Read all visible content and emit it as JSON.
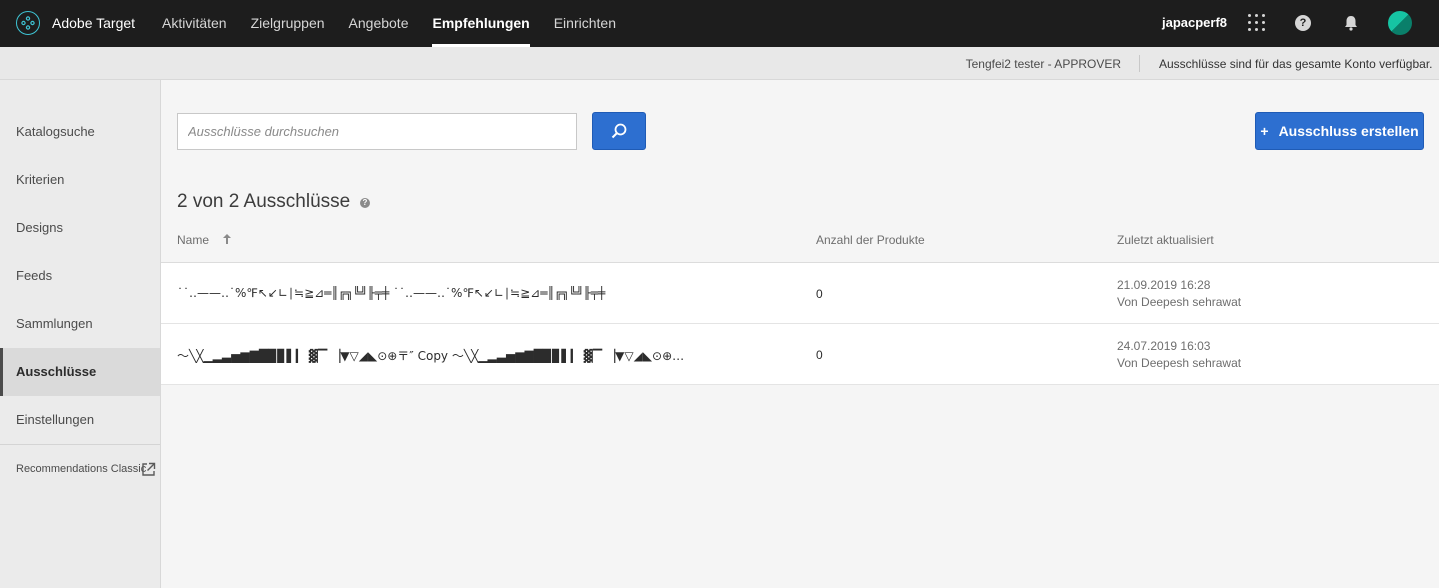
{
  "app": {
    "name": "Adobe Target",
    "logo_icon": "adobe-target-logo-icon"
  },
  "topnav": {
    "items": [
      {
        "label": "Aktivitäten",
        "active": false
      },
      {
        "label": "Zielgruppen",
        "active": false
      },
      {
        "label": "Angebote",
        "active": false
      },
      {
        "label": "Empfehlungen",
        "active": true
      },
      {
        "label": "Einrichten",
        "active": false
      }
    ],
    "user": "japacperf8",
    "icons": [
      "apps-grid-icon",
      "help-icon",
      "bell-icon",
      "avatar"
    ]
  },
  "subbar": {
    "user_role": "Tengfei2 tester - APPROVER",
    "note": "Ausschlüsse sind für das gesamte Konto verfügbar."
  },
  "sidebar": {
    "items": [
      {
        "label": "Katalogsuche",
        "active": false
      },
      {
        "label": "Kriterien",
        "active": false
      },
      {
        "label": "Designs",
        "active": false
      },
      {
        "label": "Feeds",
        "active": false
      },
      {
        "label": "Sammlungen",
        "active": false
      },
      {
        "label": "Ausschlüsse",
        "active": true
      },
      {
        "label": "Einstellungen",
        "active": false
      }
    ],
    "classic_link": "Recommendations Classic"
  },
  "main": {
    "search": {
      "placeholder": "Ausschlüsse durchsuchen",
      "value": ""
    },
    "create_button": "Ausschluss erstellen",
    "count_title": "2 von 2 Ausschlüsse",
    "table": {
      "columns": [
        "Name",
        "Anzahl der Produkte",
        "Zuletzt aktualisiert"
      ],
      "sort": {
        "column": "Name",
        "direction": "ascending"
      },
      "rows": [
        {
          "name": "˙˙‥——‥˙%℉↖↙∟∣≒≧⊿═║╔╗╚╝╟╤╪ ˙˙‥——‥˙%℉↖↙∟∣≒≧⊿═║╔╗╚╝╟╤╪",
          "count": "0",
          "date": "21.09.2019 16:28",
          "author": "Von Deepesh sehrawat"
        },
        {
          "name": "〜╲╳▁▂▃▅▆▇█▉▊▌▎ ▓▔ ▕▼▽◢◣⊙⊕〒″ Copy 〜╲╳▁▂▃▅▆▇█▉▊▌▎ ▓▔ ▕▼▽◢◣⊙⊕…",
          "count": "0",
          "date": "24.07.2019 16:03",
          "author": "Von Deepesh sehrawat"
        }
      ]
    }
  },
  "colors": {
    "topbar": "#1d1d1d",
    "accent_blue": "#2d6fd0",
    "logo_teal": "#3ec4d4",
    "avatar_green": "#16c4a3"
  }
}
